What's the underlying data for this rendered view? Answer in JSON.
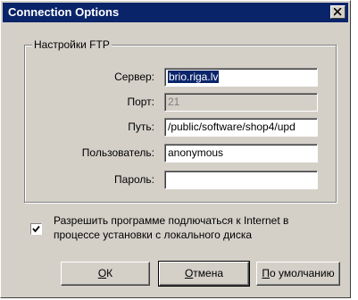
{
  "window": {
    "title": "Connection Options"
  },
  "group": {
    "legend": "Настройки FTP"
  },
  "fields": {
    "server": {
      "label": "Сервер:",
      "value": "brio.riga.lv"
    },
    "port": {
      "label": "Порт:",
      "value": "21"
    },
    "path": {
      "label": "Путь:",
      "value": "/public/software/shop4/upd"
    },
    "user": {
      "label": "Пользователь:",
      "value": "anonymous"
    },
    "password": {
      "label": "Пароль:",
      "value": ""
    }
  },
  "checkbox": {
    "checked": true,
    "line1": "Разрешить программе подлючаться к Internet в",
    "line2": "процессе установки с локального диска"
  },
  "buttons": {
    "ok": {
      "accel": "О",
      "rest": "К"
    },
    "cancel": {
      "accel": "О",
      "rest": "тмена"
    },
    "default": {
      "accel": "П",
      "rest": "о умолчанию"
    }
  }
}
